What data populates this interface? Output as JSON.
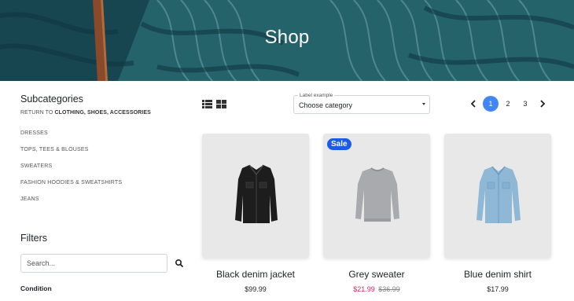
{
  "hero": {
    "title": "Shop"
  },
  "sidebar": {
    "subcategories_title": "Subcategories",
    "return_prefix": "RETURN TO",
    "return_target": "CLOTHING, SHOES, ACCESSORIES",
    "categories": [
      "Dresses",
      "Tops, Tees & Blouses",
      "Sweaters",
      "Fashion Hoodies & Sweatshirts",
      "Jeans"
    ],
    "filters_title": "Filters",
    "search_placeholder": "Search...",
    "condition_title": "Condition"
  },
  "toolbar": {
    "view_icons": [
      "list-view-icon",
      "grid-view-icon"
    ],
    "select_label": "Label example",
    "select_value": "Choose category",
    "pages": [
      "1",
      "2",
      "3"
    ],
    "active_page": "1"
  },
  "products": [
    {
      "name": "Black denim jacket",
      "price": "$99.99",
      "old_price": "",
      "sale": false
    },
    {
      "name": "Grey sweater",
      "price": "$21.99",
      "old_price": "$36.99",
      "sale": true,
      "badge": "Sale"
    },
    {
      "name": "Blue denim shirt",
      "price": "$17.99",
      "old_price": "",
      "sale": false
    }
  ],
  "colors": {
    "accent": "#4285f4",
    "sale_badge": "#1a5ce6",
    "sale_price": "#e0245e"
  }
}
